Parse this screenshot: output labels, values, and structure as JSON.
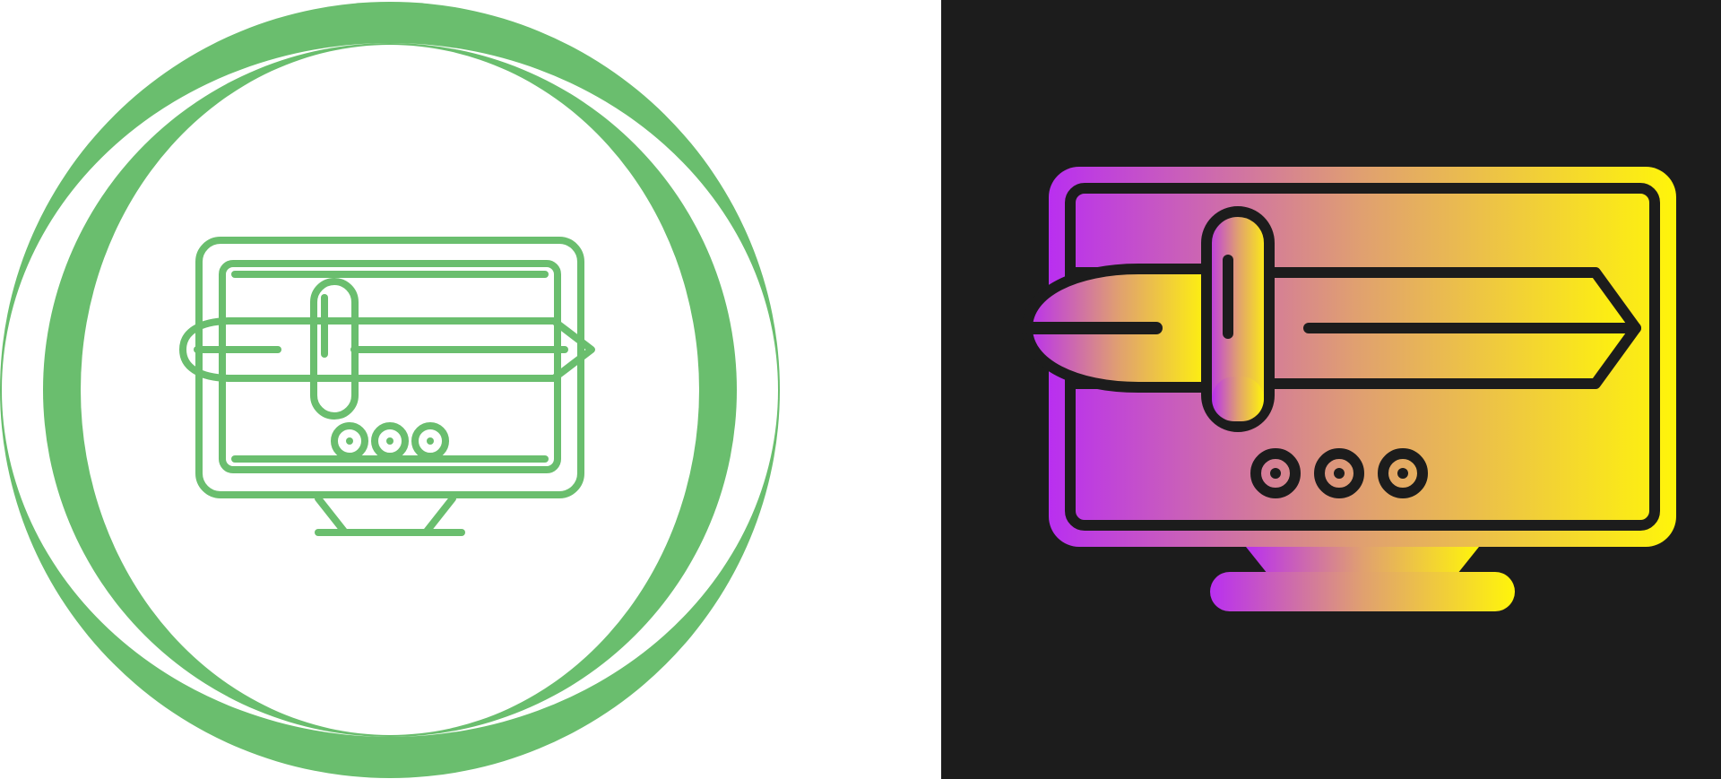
{
  "icons": [
    {
      "name": "computer-pen-line-icon",
      "style": "line",
      "background": "#ffffff",
      "stroke_color": "#6abe6e"
    },
    {
      "name": "computer-pen-gradient-icon",
      "style": "gradient-filled",
      "background": "#1c1c1c",
      "gradient_start": "#b92ff0",
      "gradient_end": "#fff50a",
      "outline_color": "#1c1c1c"
    }
  ]
}
